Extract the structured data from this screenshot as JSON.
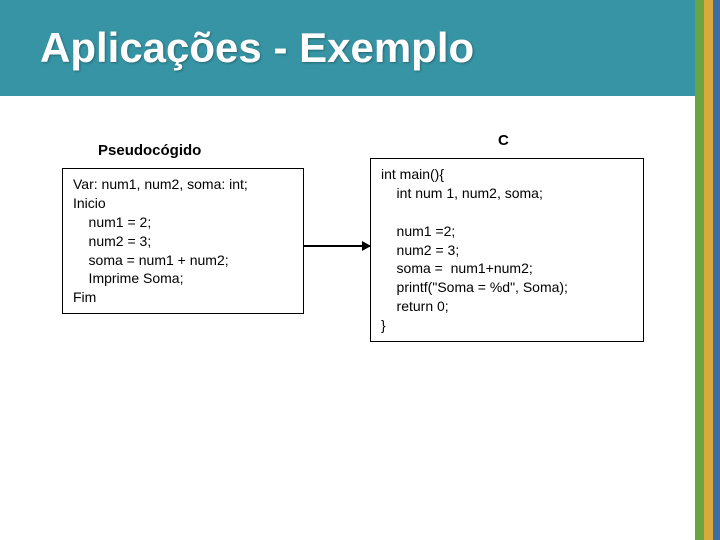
{
  "title": "Aplicações - Exemplo",
  "labels": {
    "left": "Pseudocógido",
    "right": "C"
  },
  "code": {
    "left": "Var: num1, num2, soma: int;\nInicio\n    num1 = 2;\n    num2 = 3;\n    soma = num1 + num2;\n    Imprime Soma;\nFim",
    "right": "int main(){\n    int num 1, num2, soma;\n\n    num1 =2;\n    num2 = 3;\n    soma =  num1+num2;\n    printf(\"Soma = %d\", Soma);\n    return 0;\n}"
  }
}
